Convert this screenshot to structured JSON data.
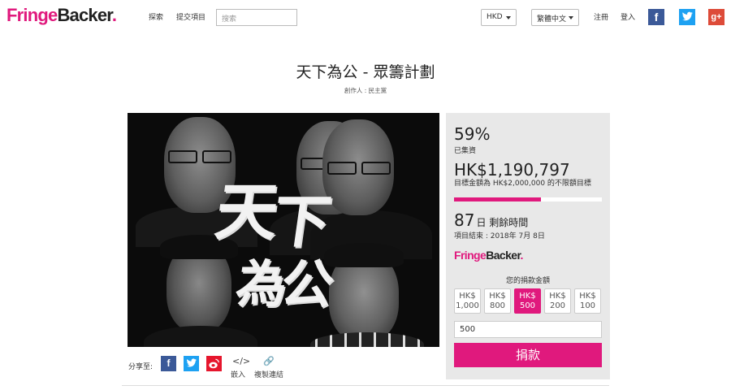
{
  "header": {
    "logo": {
      "part1": "Fringe",
      "part2": "Backer",
      "dot": "."
    },
    "nav": {
      "explore": "探索",
      "submit": "提交項目"
    },
    "search": {
      "placeholder": "搜索"
    },
    "currency": "HKD",
    "language": "繁體中文",
    "register": "注冊",
    "login": "登入",
    "social_icons": [
      "facebook-icon",
      "twitter-icon",
      "google-plus-icon"
    ]
  },
  "project": {
    "title": "天下為公 - 眾籌計劃",
    "creator": "創作人 : 民主黨",
    "hero_calligraphy": [
      "天",
      "下",
      "為",
      "公"
    ]
  },
  "share": {
    "label": "分享至:",
    "embed_label": "嵌入",
    "copy_link_label": "複製連結"
  },
  "panel": {
    "percent": "59%",
    "percent_label": "已集資",
    "amount": "HK$1,190,797",
    "goal_text": "目標金額為 HK$2,000,000 的不限額目標",
    "progress_fraction": 0.59,
    "days_number": "87",
    "days_text": "日 剩餘時間",
    "end_date": "項目結束 : 2018年 7月 8日",
    "logo": {
      "part1": "Fringe",
      "part2": "Backer",
      "dot": "."
    },
    "amount_label": "您的捐款金額",
    "options": [
      {
        "currency": "HK$",
        "value": "1,000",
        "selected": false
      },
      {
        "currency": "HK$",
        "value": "800",
        "selected": false
      },
      {
        "currency": "HK$",
        "value": "500",
        "selected": true
      },
      {
        "currency": "HK$",
        "value": "200",
        "selected": false
      },
      {
        "currency": "HK$",
        "value": "100",
        "selected": false
      }
    ],
    "input_value": "500",
    "donate_label": "捐款"
  },
  "colors": {
    "brand": "#e0197d",
    "facebook": "#3b5998",
    "twitter": "#1da1f2",
    "google_plus": "#dd4b39",
    "weibo": "#e6162d",
    "panel_bg": "#e8e8e8"
  }
}
